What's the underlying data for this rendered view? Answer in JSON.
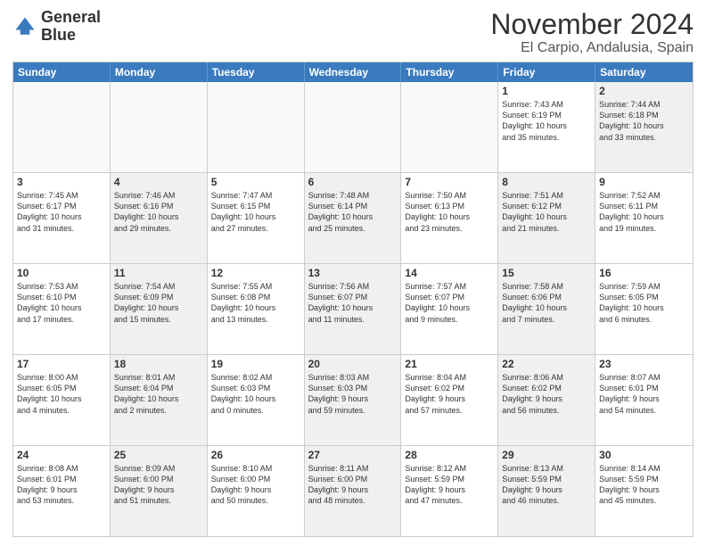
{
  "logo": {
    "line1": "General",
    "line2": "Blue"
  },
  "title": "November 2024",
  "location": "El Carpio, Andalusia, Spain",
  "header_days": [
    "Sunday",
    "Monday",
    "Tuesday",
    "Wednesday",
    "Thursday",
    "Friday",
    "Saturday"
  ],
  "rows": [
    [
      {
        "day": "",
        "text": "",
        "empty": true
      },
      {
        "day": "",
        "text": "",
        "empty": true
      },
      {
        "day": "",
        "text": "",
        "empty": true
      },
      {
        "day": "",
        "text": "",
        "empty": true
      },
      {
        "day": "",
        "text": "",
        "empty": true
      },
      {
        "day": "1",
        "text": "Sunrise: 7:43 AM\nSunset: 6:19 PM\nDaylight: 10 hours\nand 35 minutes.",
        "empty": false
      },
      {
        "day": "2",
        "text": "Sunrise: 7:44 AM\nSunset: 6:18 PM\nDaylight: 10 hours\nand 33 minutes.",
        "empty": false,
        "shaded": true
      }
    ],
    [
      {
        "day": "3",
        "text": "Sunrise: 7:45 AM\nSunset: 6:17 PM\nDaylight: 10 hours\nand 31 minutes.",
        "empty": false
      },
      {
        "day": "4",
        "text": "Sunrise: 7:46 AM\nSunset: 6:16 PM\nDaylight: 10 hours\nand 29 minutes.",
        "empty": false,
        "shaded": true
      },
      {
        "day": "5",
        "text": "Sunrise: 7:47 AM\nSunset: 6:15 PM\nDaylight: 10 hours\nand 27 minutes.",
        "empty": false
      },
      {
        "day": "6",
        "text": "Sunrise: 7:48 AM\nSunset: 6:14 PM\nDaylight: 10 hours\nand 25 minutes.",
        "empty": false,
        "shaded": true
      },
      {
        "day": "7",
        "text": "Sunrise: 7:50 AM\nSunset: 6:13 PM\nDaylight: 10 hours\nand 23 minutes.",
        "empty": false
      },
      {
        "day": "8",
        "text": "Sunrise: 7:51 AM\nSunset: 6:12 PM\nDaylight: 10 hours\nand 21 minutes.",
        "empty": false,
        "shaded": true
      },
      {
        "day": "9",
        "text": "Sunrise: 7:52 AM\nSunset: 6:11 PM\nDaylight: 10 hours\nand 19 minutes.",
        "empty": false
      }
    ],
    [
      {
        "day": "10",
        "text": "Sunrise: 7:53 AM\nSunset: 6:10 PM\nDaylight: 10 hours\nand 17 minutes.",
        "empty": false
      },
      {
        "day": "11",
        "text": "Sunrise: 7:54 AM\nSunset: 6:09 PM\nDaylight: 10 hours\nand 15 minutes.",
        "empty": false,
        "shaded": true
      },
      {
        "day": "12",
        "text": "Sunrise: 7:55 AM\nSunset: 6:08 PM\nDaylight: 10 hours\nand 13 minutes.",
        "empty": false
      },
      {
        "day": "13",
        "text": "Sunrise: 7:56 AM\nSunset: 6:07 PM\nDaylight: 10 hours\nand 11 minutes.",
        "empty": false,
        "shaded": true
      },
      {
        "day": "14",
        "text": "Sunrise: 7:57 AM\nSunset: 6:07 PM\nDaylight: 10 hours\nand 9 minutes.",
        "empty": false
      },
      {
        "day": "15",
        "text": "Sunrise: 7:58 AM\nSunset: 6:06 PM\nDaylight: 10 hours\nand 7 minutes.",
        "empty": false,
        "shaded": true
      },
      {
        "day": "16",
        "text": "Sunrise: 7:59 AM\nSunset: 6:05 PM\nDaylight: 10 hours\nand 6 minutes.",
        "empty": false
      }
    ],
    [
      {
        "day": "17",
        "text": "Sunrise: 8:00 AM\nSunset: 6:05 PM\nDaylight: 10 hours\nand 4 minutes.",
        "empty": false
      },
      {
        "day": "18",
        "text": "Sunrise: 8:01 AM\nSunset: 6:04 PM\nDaylight: 10 hours\nand 2 minutes.",
        "empty": false,
        "shaded": true
      },
      {
        "day": "19",
        "text": "Sunrise: 8:02 AM\nSunset: 6:03 PM\nDaylight: 10 hours\nand 0 minutes.",
        "empty": false
      },
      {
        "day": "20",
        "text": "Sunrise: 8:03 AM\nSunset: 6:03 PM\nDaylight: 9 hours\nand 59 minutes.",
        "empty": false,
        "shaded": true
      },
      {
        "day": "21",
        "text": "Sunrise: 8:04 AM\nSunset: 6:02 PM\nDaylight: 9 hours\nand 57 minutes.",
        "empty": false
      },
      {
        "day": "22",
        "text": "Sunrise: 8:06 AM\nSunset: 6:02 PM\nDaylight: 9 hours\nand 56 minutes.",
        "empty": false,
        "shaded": true
      },
      {
        "day": "23",
        "text": "Sunrise: 8:07 AM\nSunset: 6:01 PM\nDaylight: 9 hours\nand 54 minutes.",
        "empty": false
      }
    ],
    [
      {
        "day": "24",
        "text": "Sunrise: 8:08 AM\nSunset: 6:01 PM\nDaylight: 9 hours\nand 53 minutes.",
        "empty": false
      },
      {
        "day": "25",
        "text": "Sunrise: 8:09 AM\nSunset: 6:00 PM\nDaylight: 9 hours\nand 51 minutes.",
        "empty": false,
        "shaded": true
      },
      {
        "day": "26",
        "text": "Sunrise: 8:10 AM\nSunset: 6:00 PM\nDaylight: 9 hours\nand 50 minutes.",
        "empty": false
      },
      {
        "day": "27",
        "text": "Sunrise: 8:11 AM\nSunset: 6:00 PM\nDaylight: 9 hours\nand 48 minutes.",
        "empty": false,
        "shaded": true
      },
      {
        "day": "28",
        "text": "Sunrise: 8:12 AM\nSunset: 5:59 PM\nDaylight: 9 hours\nand 47 minutes.",
        "empty": false
      },
      {
        "day": "29",
        "text": "Sunrise: 8:13 AM\nSunset: 5:59 PM\nDaylight: 9 hours\nand 46 minutes.",
        "empty": false,
        "shaded": true
      },
      {
        "day": "30",
        "text": "Sunrise: 8:14 AM\nSunset: 5:59 PM\nDaylight: 9 hours\nand 45 minutes.",
        "empty": false
      }
    ]
  ]
}
